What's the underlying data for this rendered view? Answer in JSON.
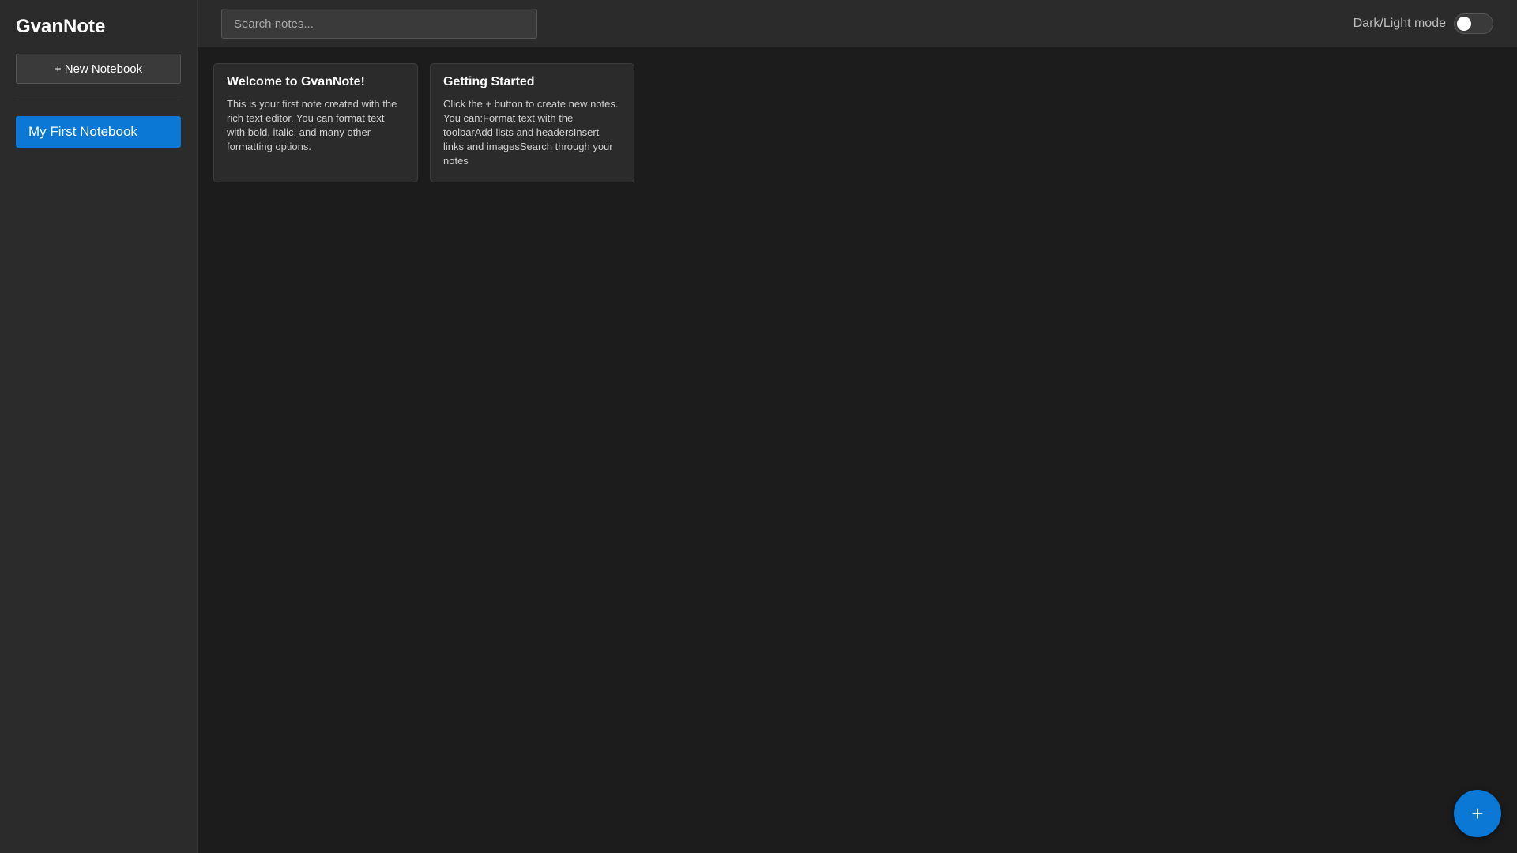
{
  "app": {
    "title": "GvanNote"
  },
  "sidebar": {
    "new_notebook_label": "+ New Notebook",
    "notebooks": [
      {
        "label": "My First Notebook",
        "active": true
      }
    ]
  },
  "header": {
    "search_placeholder": "Search notes...",
    "theme_toggle_label": "Dark/Light mode",
    "theme_toggle_on": false
  },
  "notes": [
    {
      "title": "Welcome to GvanNote!",
      "body": "This is your first note created with the rich text editor. You can format text with bold, italic, and many other formatting options."
    },
    {
      "title": "Getting Started",
      "body": "Click the + button to create new notes. You can:Format text with the toolbarAdd lists and headersInsert links and imagesSearch through your notes"
    }
  ],
  "fab": {
    "label": "+"
  },
  "colors": {
    "accent": "#0a78d4",
    "background": "#1c1c1c",
    "panel": "#2b2b2b"
  }
}
